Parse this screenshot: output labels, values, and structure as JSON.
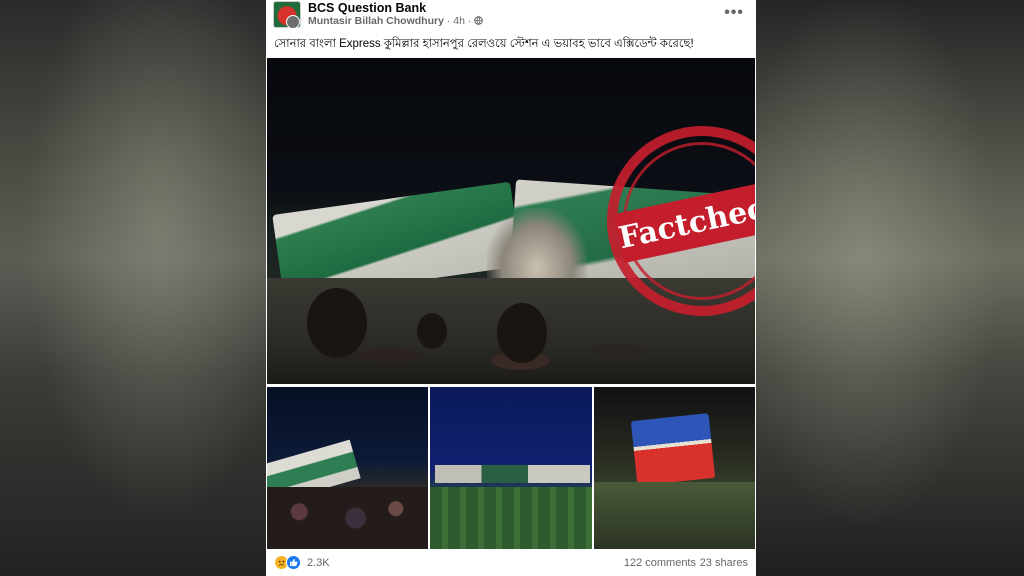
{
  "post": {
    "page_name": "BCS Question Bank",
    "author": "Muntasir Billah Chowdhury",
    "time": "4h",
    "separator": "·",
    "audience_icon": "globe-icon",
    "more_label": "•••",
    "caption": "সোনার বাংলা Express  কুমিল্লার হাসানপুর রেলওয়ে স্টেশন এ ভয়াবহ ভাবে এক্সিডেন্ট করেছে!"
  },
  "stamp": {
    "text": "Factcheck",
    "color": "#c41e2d"
  },
  "footer": {
    "reactions": [
      "sad-reaction-icon",
      "like-reaction-icon"
    ],
    "reaction_count": "2.3K",
    "comments": "122 comments",
    "shares": "23 shares"
  },
  "colors": {
    "facebook_blue": "#1877f2",
    "train_green": "#2e7d4f"
  }
}
